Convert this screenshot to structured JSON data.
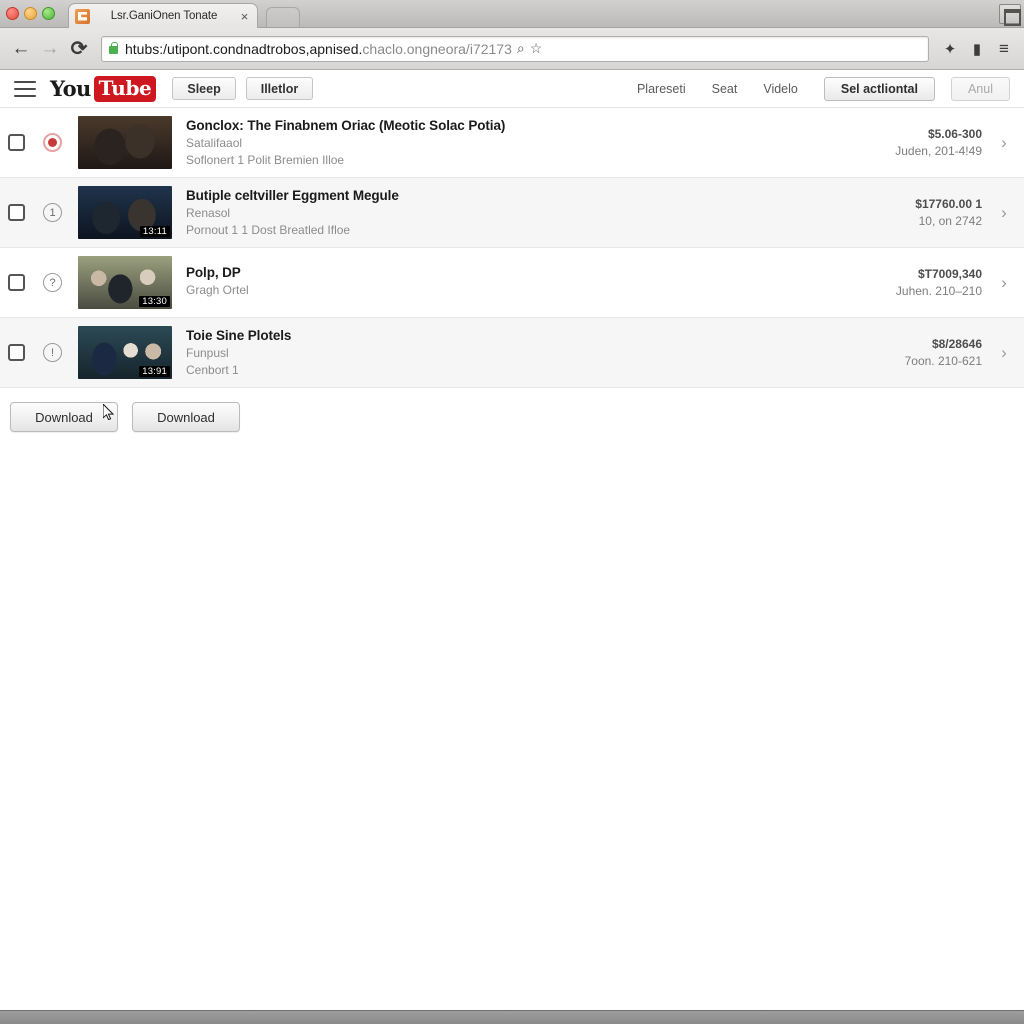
{
  "browser": {
    "tab": {
      "title": "Lsr.GaniOnen Tonate",
      "close_label": "×",
      "favicon_name": "page-favicon"
    },
    "nav": {
      "back_label": "←",
      "forward_label": "→",
      "reload_label": "⟳"
    },
    "omnibox": {
      "url_strong": "htubs:/utipont.condnadtrobos,apnised.",
      "url_rest": "chaclo.ongneora/i72173",
      "search_icon_label": "⌕",
      "bookmark_icon_label": "☆"
    },
    "toolbar": {
      "extension1_label": "✦",
      "extension2_label": "▮",
      "menu_label": "≡"
    }
  },
  "site_header": {
    "logo_you": "You",
    "logo_tube": "Tube",
    "buttons": [
      {
        "label": "Sleep",
        "name": "sleep-button"
      },
      {
        "label": "Illetlor",
        "name": "illetlor-button"
      }
    ],
    "links": [
      {
        "label": "Plareseti",
        "name": "plareseti-link"
      },
      {
        "label": "Seat",
        "name": "seat-link"
      },
      {
        "label": "Videlo",
        "name": "videlo-link"
      }
    ],
    "primary_button": "Sel actliontal",
    "secondary_button": "Anul"
  },
  "list": {
    "rows": [
      {
        "badge": "●",
        "badge_type": "record",
        "duration": "",
        "title": "Gonclox: The Finabnem Oriac (Meotic Solac Potia)",
        "subtitle": "Satalifaaol",
        "subtitle2": "Soflonert 1 Polit Bremien Illoe",
        "amount": "$5.06-300",
        "meta": "Juden, 201-4!49",
        "chevron": "›"
      },
      {
        "badge": "1",
        "badge_type": "number",
        "duration": "13:11",
        "title": "Butiple celtviller Eggment Megule",
        "subtitle": "Renasol",
        "subtitle2": "Pornout 1 1 Dost Breatled Ifloe",
        "amount": "$17760.00 1",
        "meta": "10, on 2742",
        "chevron": "›"
      },
      {
        "badge": "?",
        "badge_type": "question",
        "duration": "13:30",
        "title": "Polp, DP",
        "subtitle": "Gragh Ortel",
        "subtitle2": "",
        "amount": "$T7009,340",
        "meta": "Juhen. 210–210",
        "chevron": "›"
      },
      {
        "badge": "!",
        "badge_type": "alert",
        "duration": "13:91",
        "title": "Toie Sine Plotels",
        "subtitle": "Funpusl",
        "subtitle2": "Cenbort 1",
        "amount": "$8/28646",
        "meta": "7oon. 210-621",
        "chevron": "›"
      }
    ]
  },
  "actions": {
    "download_primary": "Download",
    "download_secondary": "Download"
  },
  "colors": {
    "brand_red": "#cc181e",
    "row_alt": "#f6f6f6",
    "text_primary": "#1b1b1b",
    "text_muted": "#8c8c8c"
  }
}
